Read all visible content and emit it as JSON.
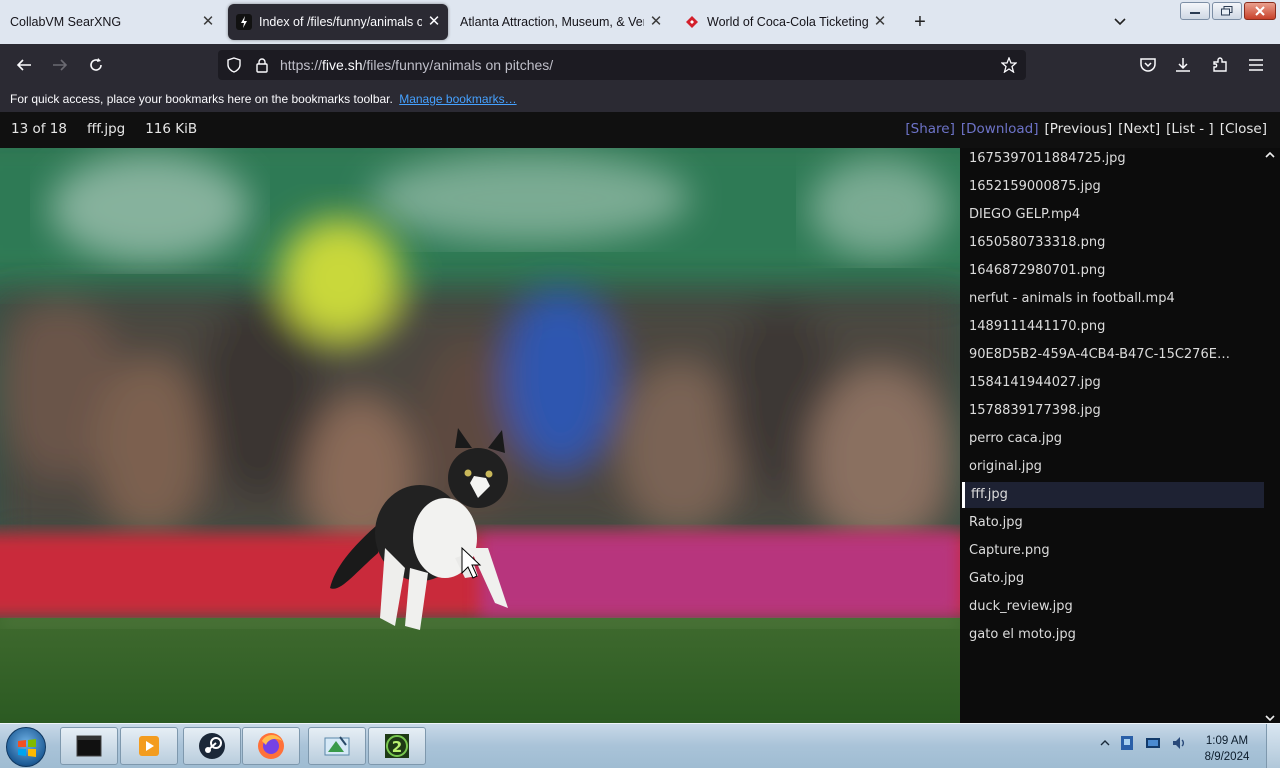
{
  "tabs": [
    {
      "label": "CollabVM SearXNG",
      "active": false,
      "favicon": "none"
    },
    {
      "label": "Index of /files/funny/animals on pitches/",
      "active": true,
      "favicon": "bolt-icon"
    },
    {
      "label": "Atlanta Attraction, Museum, & Venue",
      "active": false,
      "favicon": "none"
    },
    {
      "label": "World of Coca-Cola Ticketing System",
      "active": false,
      "favicon": "ticket-icon"
    }
  ],
  "toolbar": {
    "new_tab_icon": "plus-icon",
    "list_tabs_icon": "chevron-down-icon"
  },
  "nav": {
    "url_scheme": "https://",
    "url_host": "five.sh",
    "url_path": "/files/funny/animals on pitches/"
  },
  "bookmarks_bar": {
    "message": "For quick access, place your bookmarks here on the bookmarks toolbar.",
    "manage_link": "Manage bookmarks…"
  },
  "viewer": {
    "position": "13 of 18",
    "filename": "fff.jpg",
    "size": "116 KiB",
    "share": "[Share]",
    "download": "[Download]",
    "previous": "[Previous]",
    "next": "[Next]",
    "list": "[List - ]",
    "close": "[Close]"
  },
  "files": [
    "1675397011884725.jpg",
    "1652159000875.jpg",
    "DIEGO GELP.mp4",
    "1650580733318.png",
    "1646872980701.png",
    "nerfut - animals in football.mp4",
    "1489111441170.png",
    "90E8D5B2-459A-4CB4-B47C-15C276E…",
    "1584141944027.jpg",
    "1578839177398.jpg",
    "perro caca.jpg",
    "original.jpg",
    "fff.jpg",
    "Rato.jpg",
    "Capture.png",
    "Gato.jpg",
    "duck_review.jpg",
    "gato el moto.jpg"
  ],
  "selected_file_index": 12,
  "taskbar": {
    "apps": [
      "terminal-icon",
      "media-player-icon",
      "steam-icon",
      "firefox-icon",
      "paint-icon",
      "game-icon"
    ],
    "time": "1:09 AM",
    "date": "8/9/2024"
  },
  "colors": {
    "accent_link": "#45a1ff",
    "viewer_dim_link": "#6d73c8",
    "browser_dark": "#2b2a33"
  }
}
